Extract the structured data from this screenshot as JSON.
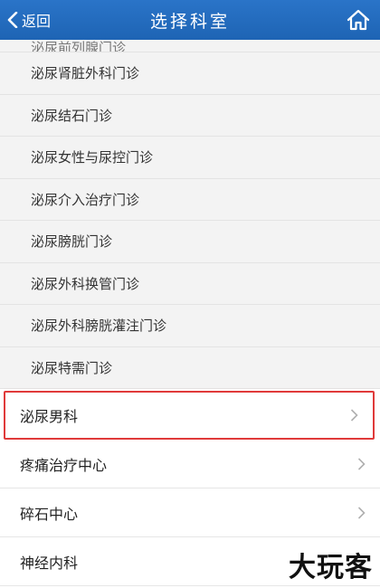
{
  "header": {
    "back_label": "返回",
    "title": "选择科室"
  },
  "sub_departments": [
    "泌尿前列腺门诊",
    "泌尿肾脏外科门诊",
    "泌尿结石门诊",
    "泌尿女性与尿控门诊",
    "泌尿介入治疗门诊",
    "泌尿膀胱门诊",
    "泌尿外科换管门诊",
    "泌尿外科膀胱灌注门诊",
    "泌尿特需门诊"
  ],
  "departments": [
    "泌尿男科",
    "疼痛治疗中心",
    "碎石中心",
    "神经内科"
  ],
  "watermark": "大玩客",
  "colors": {
    "header_bg": "#1e64b4",
    "highlight_border": "#e03a3a"
  }
}
